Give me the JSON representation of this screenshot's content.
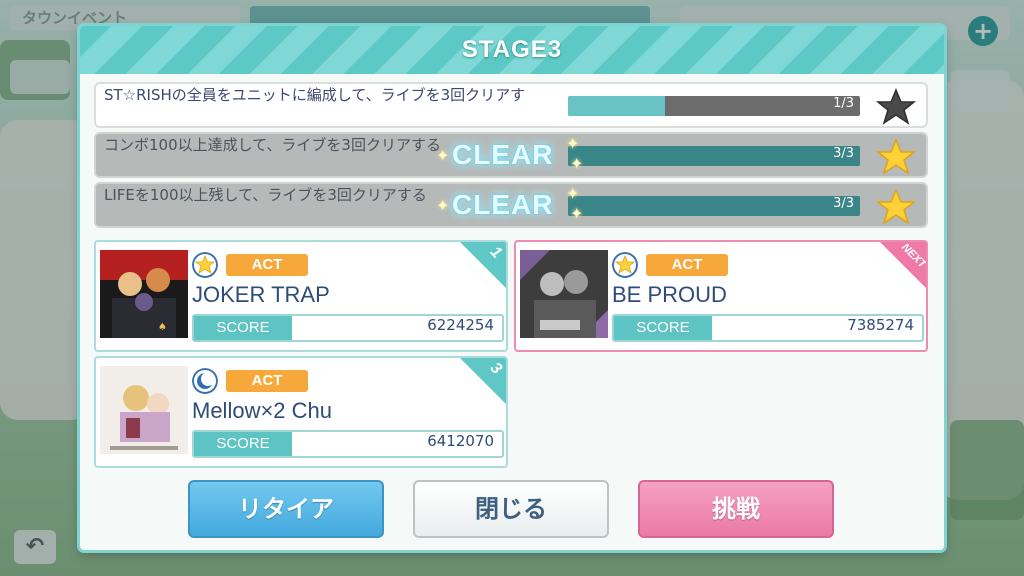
{
  "background": {
    "top_label": "タウンイベント",
    "back_glyph": "↶",
    "plus_glyph": "+"
  },
  "dialog": {
    "title": "STAGE3",
    "missions": [
      {
        "text": "ST☆RISHの全員をユニットに編成して、ライブを3回クリアす",
        "progress": "1/3",
        "fraction": 0.333,
        "cleared": false,
        "star": "star-empty-icon"
      },
      {
        "text": "コンボ100以上達成して、ライブを3回クリアする",
        "progress": "3/3",
        "fraction": 1.0,
        "cleared": true,
        "clear_label": "CLEAR",
        "star": "star-gold-icon"
      },
      {
        "text": "LIFEを100以上残して、ライブを3回クリアする",
        "progress": "3/3",
        "fraction": 1.0,
        "cleared": true,
        "clear_label": "CLEAR",
        "star": "star-gold-icon"
      }
    ],
    "songs": [
      {
        "title": "JOKER TRAP",
        "type": "ACT",
        "score_label": "SCORE",
        "score": "6224254",
        "corner": "1",
        "rank_icon": "star-rank-icon"
      },
      {
        "title": "BE PROUD",
        "type": "ACT",
        "score_label": "SCORE",
        "score": "7385274",
        "corner": "NEXT",
        "rank_icon": "star-rank-icon"
      },
      {
        "title": "Mellow×2 Chu",
        "type": "ACT",
        "score_label": "SCORE",
        "score": "6412070",
        "corner": "3",
        "rank_icon": "moon-rank-icon"
      }
    ],
    "buttons": {
      "retire": "リタイア",
      "close": "閉じる",
      "challenge": "挑戦"
    }
  },
  "colors": {
    "accent": "#5cc9c6",
    "next": "#f07aa7",
    "act": "#f7a83a"
  }
}
